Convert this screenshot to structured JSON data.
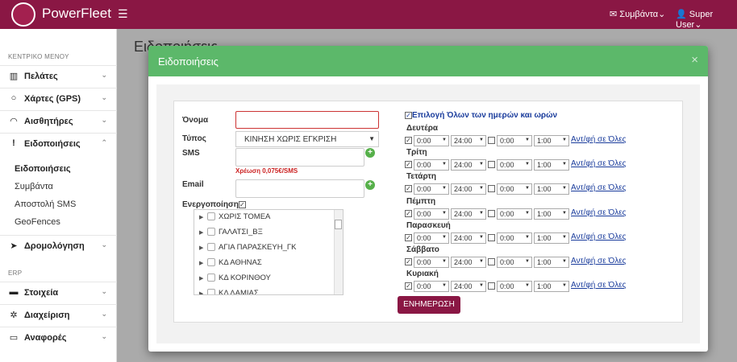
{
  "app": {
    "name": "PowerFleet"
  },
  "topbar": {
    "alerts_label": "Συμβάντα",
    "user_label": "Super User"
  },
  "sidebar": {
    "main_section": "ΚΕΝΤΡΙΚΟ ΜΕΝΟΥ",
    "items": [
      {
        "label": "Πελάτες",
        "icon": "map-icon"
      },
      {
        "label": "Χάρτες (GPS)",
        "icon": "globe-icon"
      },
      {
        "label": "Αισθητήρες",
        "icon": "gauge-icon"
      },
      {
        "label": "Ειδοποιήσεις",
        "icon": "exclamation-icon"
      }
    ],
    "subitems": [
      "Ειδοποιήσεις",
      "Συμβάντα",
      "Αποστολή SMS",
      "GeoFences"
    ],
    "routing": {
      "label": "Δρομολόγηση"
    },
    "erp_section": "ERP",
    "erp_items": [
      {
        "label": "Στοιχεία",
        "icon": "truck-icon"
      },
      {
        "label": "Διαχείριση",
        "icon": "gear-icon"
      },
      {
        "label": "Αναφορές",
        "icon": "monitor-icon"
      }
    ]
  },
  "page": {
    "title": "Ειδοποιήσεις"
  },
  "modal": {
    "title": "Ειδοποιήσεις",
    "close": "×",
    "form": {
      "name_label": "Όνομα",
      "name_value": "",
      "type_label": "Τύπος",
      "type_value": "ΚΙΝΗΣΗ ΧΩΡΙΣ ΕΓΚΡΙΣΗ",
      "sms_label": "SMS",
      "sms_charge": "Χρέωση 0,075€/SMS",
      "email_label": "Email",
      "enable_label": "Ενεργοποίηση",
      "enable_checked": true
    },
    "tree_items": [
      "ΧΩΡΙΣ ΤΟΜΕΑ",
      "ΓΑΛΑΤΣΙ_ΒΞ",
      "ΑΓΙΑ ΠΑΡΑΣΚΕΥΗ_ΓΚ",
      "ΚΔ ΑΘΗΝΑΣ",
      "ΚΔ ΚΟΡΙΝΘΟΥ",
      "ΚΔ ΛΑΜΙΑΣ"
    ],
    "schedule": {
      "select_all_label": "Επιλογή Όλων των ημερών και ωρών",
      "invert_label": "Αντ/φή σε Όλες",
      "days": [
        {
          "name": "Δευτέρα",
          "from1": "0:00",
          "to1": "24:00",
          "from2": "0:00",
          "to2": "1:00"
        },
        {
          "name": "Τρίτη",
          "from1": "0:00",
          "to1": "24:00",
          "from2": "0:00",
          "to2": "1:00"
        },
        {
          "name": "Τετάρτη",
          "from1": "0:00",
          "to1": "24:00",
          "from2": "0:00",
          "to2": "1:00"
        },
        {
          "name": "Πέμπτη",
          "from1": "0:00",
          "to1": "24:00",
          "from2": "0:00",
          "to2": "1:00"
        },
        {
          "name": "Παρασκευή",
          "from1": "0:00",
          "to1": "24:00",
          "from2": "0:00",
          "to2": "1:00"
        },
        {
          "name": "Σάββατο",
          "from1": "0:00",
          "to1": "24:00",
          "from2": "0:00",
          "to2": "1:00"
        },
        {
          "name": "Κυριακή",
          "from1": "0:00",
          "to1": "24:00",
          "from2": "0:00",
          "to2": "1:00"
        }
      ]
    },
    "update_button": "ΕΝΗΜΕΡΩΣΗ"
  },
  "colors": {
    "brand": "#8a1744",
    "modal_header": "#5cb86a",
    "link": "#1a3c9c",
    "error": "#cc2222"
  }
}
